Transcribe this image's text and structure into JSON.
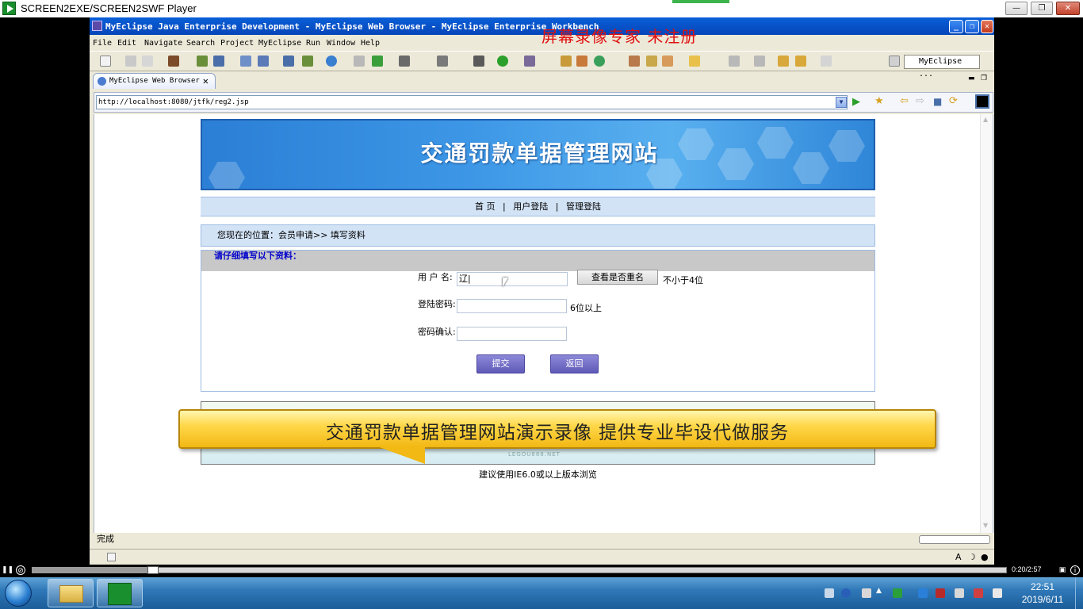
{
  "player": {
    "title": "SCREEN2EXE/SCREEN2SWF Player",
    "time": "0:20/2:57",
    "progress_fraction": 0.12
  },
  "eclipse": {
    "title": "MyEclipse Java Enterprise Development - MyEclipse Web Browser - MyEclipse Enterprise Workbench",
    "watermark": "屏幕录像专家  未注册",
    "menu": [
      "File",
      "Edit",
      "Navigate",
      "Search",
      "Project",
      "MyEclipse",
      "Run",
      "Window",
      "Help"
    ],
    "perspective": "MyEclipse ...",
    "tab_label": "MyEclipse Web Browser",
    "url": "http://localhost:8080/jtfk/reg2.jsp",
    "status": "完成"
  },
  "page": {
    "banner_title": "交通罚款单据管理网站",
    "nav": [
      "首 页",
      "|",
      "用户登陆",
      "|",
      "管理登陆"
    ],
    "location": "您现在的位置：会员申请>> 填写资料",
    "form_header": "请仔细填写以下资料：",
    "fields": {
      "username_label": "用 户 名:",
      "username_value": "辽|",
      "check_button": "查看是否重名",
      "username_hint": "不小于4位",
      "password_label": "登陆密码:",
      "password_hint": "6位以上",
      "confirm_label": "密码确认:"
    },
    "submit": "提交",
    "back": "返回",
    "footer_logo": "LEGOU888.NET",
    "ie_note": "建议使用IE6.0或以上版本浏览"
  },
  "caption": "交通罚款单据管理网站演示录像  提供专业毕设代做服务",
  "taskbar": {
    "time": "22:51",
    "date": "2019/6/11"
  },
  "colors": {
    "banner": "#3d97e6",
    "nav_bg": "#d3e3f6",
    "form_header_text": "#0000cc",
    "button": "#6f6ac8",
    "caption": "#ffd84a",
    "watermark": "#e01010"
  }
}
